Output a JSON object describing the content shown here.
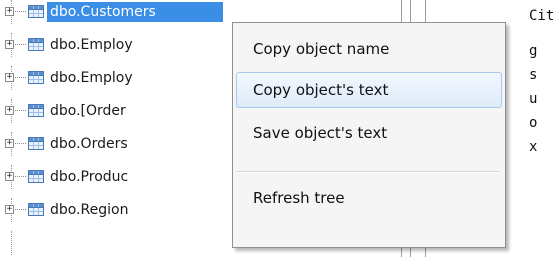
{
  "tree": {
    "items": [
      {
        "label": "dbo.Customers",
        "selected": true
      },
      {
        "label": "dbo.Employ"
      },
      {
        "label": "dbo.Employ"
      },
      {
        "label": "dbo.[Order"
      },
      {
        "label": "dbo.Orders"
      },
      {
        "label": "dbo.Produc"
      },
      {
        "label": "dbo.Region"
      }
    ],
    "expander_glyph": "+",
    "item_icon": "table-icon"
  },
  "context_menu": {
    "items": [
      {
        "label": "Copy object name"
      },
      {
        "label": "Copy object's text",
        "highlighted": true
      },
      {
        "label": "Save object's text"
      },
      {
        "label": "Refresh tree"
      }
    ]
  },
  "code_panel": {
    "lines": [
      "Cit",
      "g",
      "s",
      "u",
      "o",
      "x"
    ]
  },
  "colors": {
    "selection": "#3a8ee6",
    "menu_background": "#f5f5f5",
    "menu_highlight_border": "#a8c8ec"
  }
}
